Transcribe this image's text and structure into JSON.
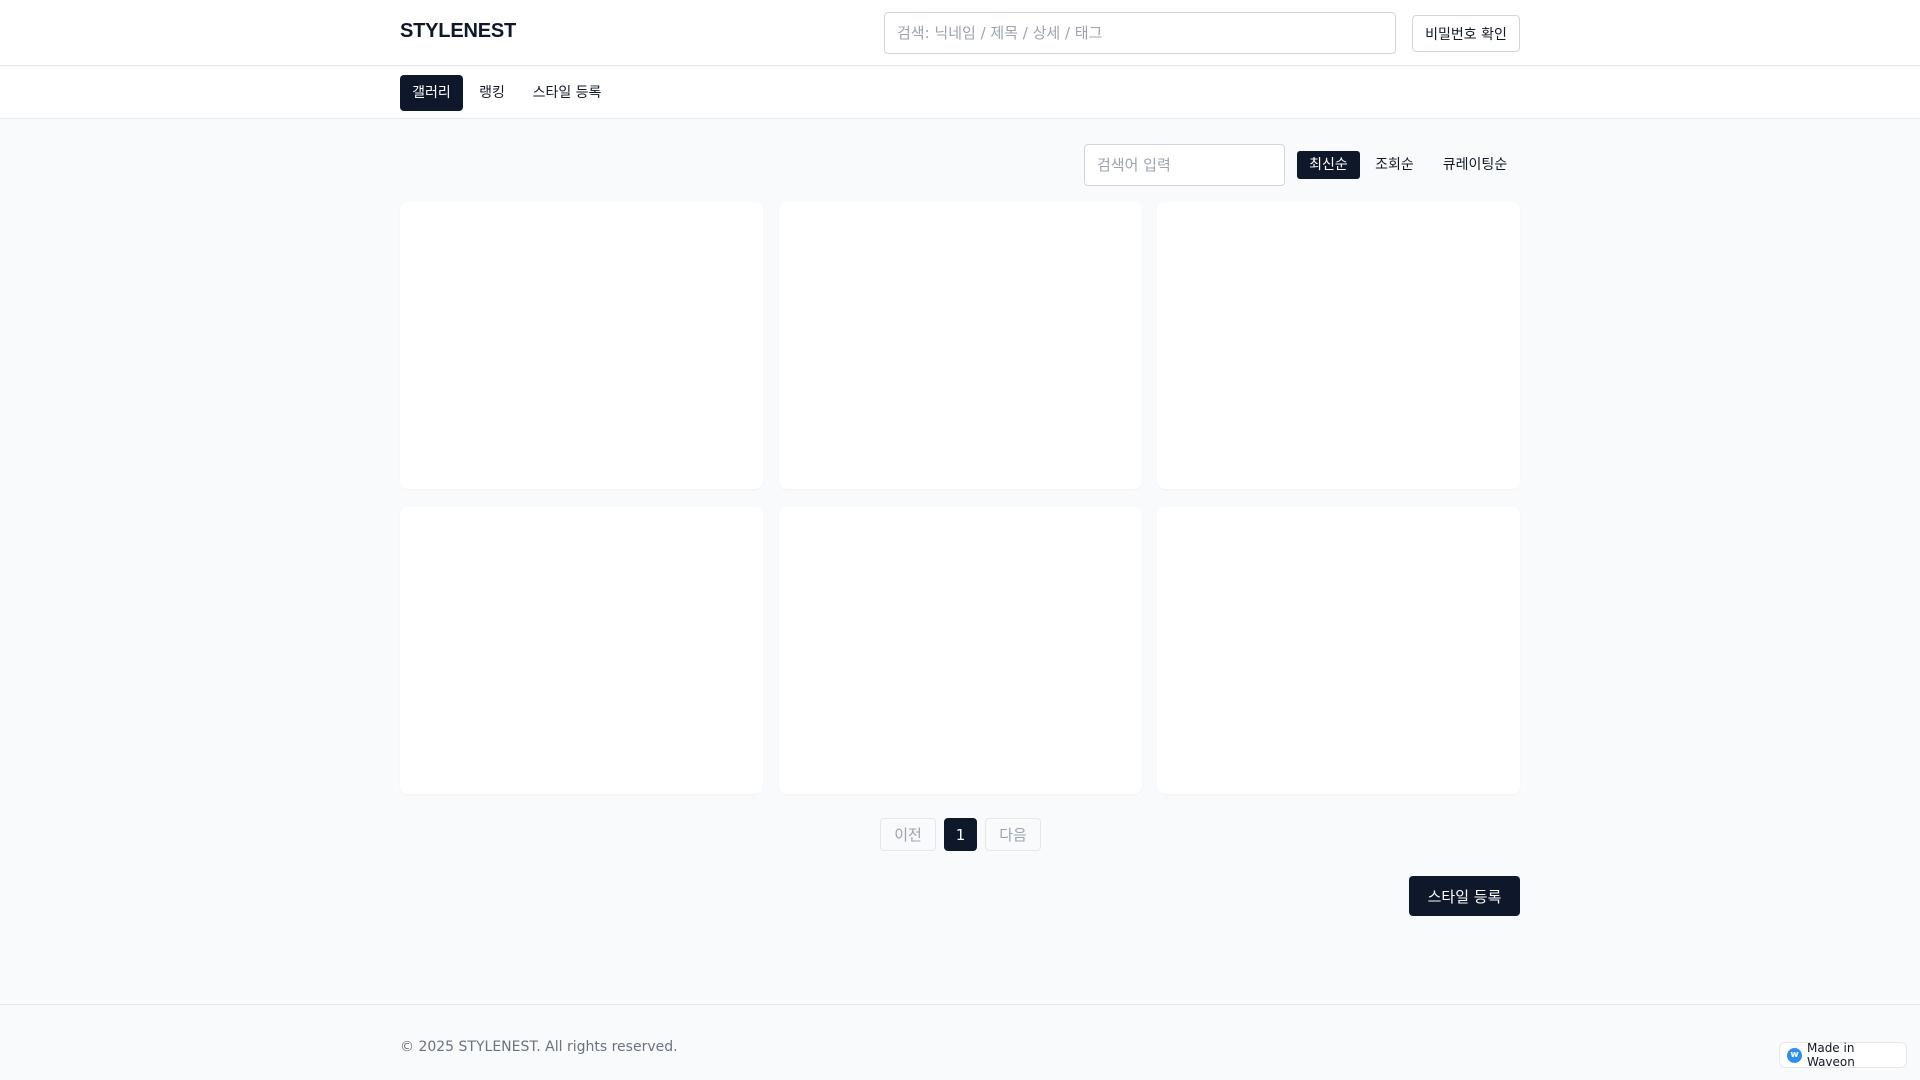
{
  "header": {
    "logo": "STYLENEST",
    "search_placeholder": "검색: 닉네임 / 제목 / 상세 / 태그",
    "password_button": "비밀번호 확인"
  },
  "nav": {
    "items": [
      {
        "label": "갤러리",
        "active": true
      },
      {
        "label": "랭킹",
        "active": false
      },
      {
        "label": "스타일 등록",
        "active": false
      }
    ]
  },
  "toolbar": {
    "filter_placeholder": "검색어 입력",
    "sort_options": [
      {
        "label": "최신순",
        "active": true
      },
      {
        "label": "조회순",
        "active": false
      },
      {
        "label": "큐레이팅순",
        "active": false
      }
    ]
  },
  "gallery": {
    "card_count": 6
  },
  "pagination": {
    "prev": "이전",
    "current": "1",
    "next": "다음"
  },
  "register_button": "스타일 등록",
  "footer": {
    "copyright": "© 2025 STYLENEST. All rights reserved."
  },
  "badge": {
    "icon": "waveon-logo-icon",
    "text": "Made in Waveon"
  },
  "colors": {
    "primary": "#0f172a",
    "background": "#f8fafc",
    "border": "#e5e7eb",
    "badge_accent": "#2b8ff0"
  }
}
